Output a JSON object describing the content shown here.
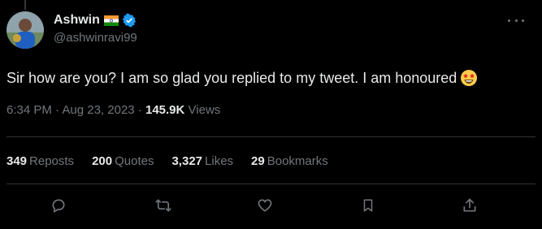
{
  "header": {
    "display_name": "Ashwin",
    "handle": "@ashwinravi99"
  },
  "tweet": {
    "text": "Sir how are you?  I am so glad you replied to my tweet. I am honoured",
    "time": "6:34 PM",
    "date": "Aug 23, 2023",
    "views_count": "145.9K",
    "views_label": "Views"
  },
  "stats": [
    {
      "num": "349",
      "label": "Reposts"
    },
    {
      "num": "200",
      "label": "Quotes"
    },
    {
      "num": "3,327",
      "label": "Likes"
    },
    {
      "num": "29",
      "label": "Bookmarks"
    }
  ],
  "icons": {
    "flag": "india-flag-icon",
    "verified": "verified-badge-icon",
    "emoji": "star-struck-emoji-icon",
    "more": "more-options-icon",
    "reply": "reply-icon",
    "repost": "repost-icon",
    "like": "like-icon",
    "bookmark": "bookmark-icon",
    "share": "share-icon"
  },
  "colors": {
    "background": "#000000",
    "text": "#e7e9ea",
    "muted": "#71767b",
    "verified": "#1d9bf0",
    "divider": "#2f3336"
  }
}
